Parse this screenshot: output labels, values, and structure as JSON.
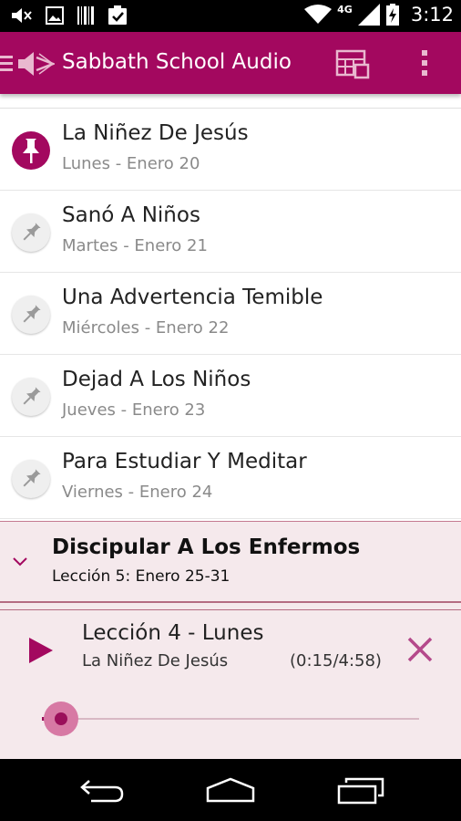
{
  "status_bar": {
    "network": "4G",
    "time": "3:12",
    "icons": [
      "volume-mute-icon",
      "image-icon",
      "barcode-icon",
      "clipboard-check-icon",
      "wifi-icon",
      "signal-icon",
      "battery-icon"
    ]
  },
  "app_bar": {
    "title": "Sabbath School Audio",
    "icons": [
      "menu-icon",
      "speaker-logo-icon",
      "calendar-icon",
      "more-vert-icon"
    ]
  },
  "lessons": [
    {
      "title": "La Niñez De Jesús",
      "subtitle": "Lunes - Enero 20",
      "pinned": true
    },
    {
      "title": "Sanó A Niños",
      "subtitle": "Martes - Enero 21",
      "pinned": false
    },
    {
      "title": "Una Advertencia Temible",
      "subtitle": "Miércoles - Enero 22",
      "pinned": false
    },
    {
      "title": "Dejad A Los Niños",
      "subtitle": "Jueves - Enero 23",
      "pinned": false
    },
    {
      "title": "Para Estudiar Y Meditar",
      "subtitle": "Viernes - Enero 24",
      "pinned": false
    }
  ],
  "group": {
    "title": "Discipular A Los Enfermos",
    "subtitle": "Lección 5: Enero 25-31"
  },
  "player": {
    "title": "Lección 4 - Lunes",
    "track": "La Niñez De Jesús",
    "time": "(0:15/4:58)",
    "progress": 0.05
  },
  "colors": {
    "accent": "#a3085f",
    "panel": "#f5e9ec",
    "seek_fill": "#9a0f5a",
    "seek_halo": "#d779a4"
  }
}
